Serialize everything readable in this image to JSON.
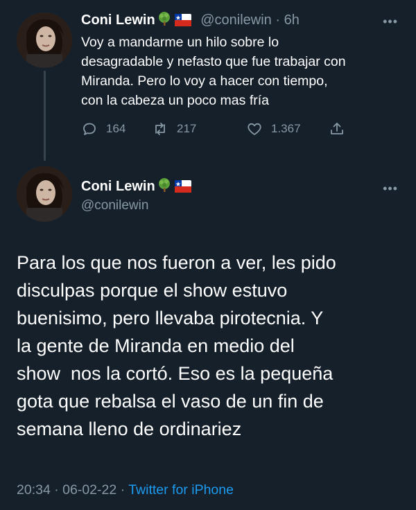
{
  "tweet1": {
    "author_name": "Coni Lewin",
    "author_icons": [
      "tree-icon",
      "chile-flag-icon"
    ],
    "handle": "@conilewin",
    "separator": "·",
    "time": "6h",
    "text_lines": [
      "Voy a mandarme un hilo sobre lo",
      "desagradable y nefasto que fue trabajar con",
      "Miranda. Pero lo voy a hacer con tiempo,",
      "con la cabeza un poco mas fría"
    ],
    "replies": "164",
    "retweets": "217",
    "likes": "1.367"
  },
  "tweet2": {
    "author_name": "Coni Lewin",
    "author_icons": [
      "tree-icon",
      "chile-flag-icon"
    ],
    "handle": "@conilewin",
    "text_lines": [
      "Para los que nos fueron a ver, les pido",
      "disculpas porque el show estuvo",
      "buenisimo, pero llevaba pirotecnia. Y",
      "la gente de Miranda en medio del",
      "show  nos la cortó. Eso es la pequeña",
      "gota que rebalsa el vaso de un fin de",
      "semana lleno de ordinariez"
    ],
    "time": "20:34",
    "separator": "·",
    "date": "06-02-22",
    "source": "Twitter for iPhone"
  },
  "colors": {
    "background": "#15202b",
    "text": "#ffffff",
    "muted": "#8899a6",
    "link": "#1d9bf0"
  }
}
